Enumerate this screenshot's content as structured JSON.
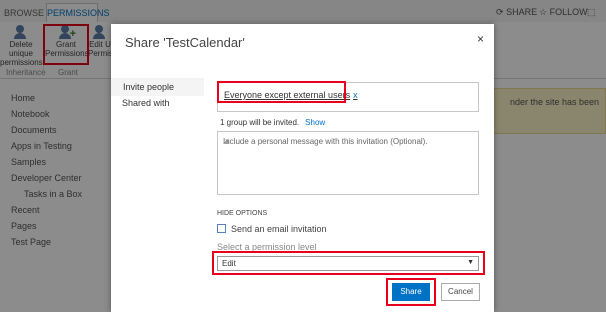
{
  "ribbon": {
    "tabs": [
      "BROWSE",
      "PERMISSIONS"
    ],
    "buttons": [
      {
        "label": "Delete unique permissions"
      },
      {
        "label": "Grant Permissions"
      },
      {
        "label": "Edit U Permiss"
      }
    ],
    "groups": [
      "Inheritance",
      "Grant"
    ],
    "share": "SHARE",
    "follow": "FOLLOW"
  },
  "nav": {
    "items": [
      "Home",
      "Notebook",
      "Documents",
      "Apps in Testing",
      "Samples",
      "Developer Center",
      "Tasks in a Box",
      "Recent",
      "Pages",
      "Test Page"
    ]
  },
  "notice": {
    "text": "nder the site has been"
  },
  "dialog": {
    "title": "Share 'TestCalendar'",
    "close": "×",
    "tabs": [
      "Invite people",
      "Shared with"
    ],
    "people_token": "Everyone except external users",
    "people_token_remove": "x",
    "invited_text": "1 group will be invited.",
    "show_link": "Show",
    "message_placeholder": "Include a personal message with this invitation (Optional).",
    "hide_options": "HIDE OPTIONS",
    "send_email_label": "Send an email invitation",
    "permission_label": "Select a permission level",
    "permission_value": "Edit",
    "share_button": "Share",
    "cancel_button": "Cancel"
  },
  "colors": {
    "accent": "#0072c6",
    "highlight": "#e8001c"
  }
}
